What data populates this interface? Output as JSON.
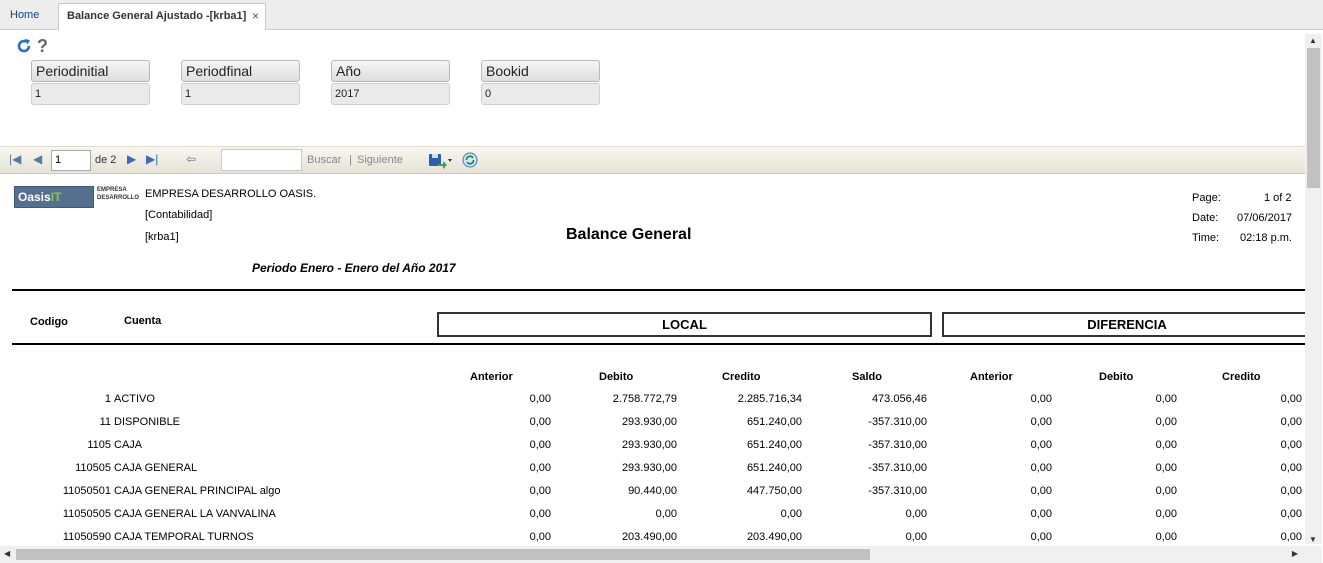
{
  "tabs": {
    "home": "Home",
    "active": "Balance General Ajustado -[krba1]",
    "close": "×"
  },
  "params": [
    {
      "label": "Periodinitial",
      "value": "1"
    },
    {
      "label": "Periodfinal",
      "value": "1"
    },
    {
      "label": "Año",
      "value": "2017"
    },
    {
      "label": "Bookid",
      "value": "0"
    }
  ],
  "toolbar": {
    "page": "1",
    "of": "de 2",
    "find": "Buscar",
    "sep": "|",
    "next": "Siguiente"
  },
  "report": {
    "logo": "Oasis",
    "logo_it": "IT",
    "logo_sub1": "EMPRESA",
    "logo_sub2": "DESARROLLO",
    "company": "EMPRESA DESARROLLO OASIS.",
    "module": "[Contabilidad]",
    "user": "[krba1]",
    "title": "Balance General",
    "period": "Periodo Enero  -  Enero  del Año  2017",
    "page_label": "Page:",
    "page_value": "1 of 2",
    "date_label": "Date:",
    "date_value": "07/06/2017",
    "time_label": "Time:",
    "time_value": "02:18 p.m.",
    "col_codigo": "Codigo",
    "col_cuenta": "Cuenta",
    "group_local": "LOCAL",
    "group_diff": "DIFERENCIA",
    "cols": [
      "Anterior",
      "Debito",
      "Credito",
      "Saldo",
      "Anterior",
      "Debito",
      "Credito"
    ]
  },
  "rows": [
    {
      "code": "1",
      "name": "ACTIVO",
      "v": [
        "0,00",
        "2.758.772,79",
        "2.285.716,34",
        "473.056,46",
        "0,00",
        "0,00",
        "0,00"
      ]
    },
    {
      "code": "11",
      "name": "DISPONIBLE",
      "v": [
        "0,00",
        "293.930,00",
        "651.240,00",
        "-357.310,00",
        "0,00",
        "0,00",
        "0,00"
      ]
    },
    {
      "code": "1105",
      "name": "CAJA",
      "v": [
        "0,00",
        "293.930,00",
        "651.240,00",
        "-357.310,00",
        "0,00",
        "0,00",
        "0,00"
      ]
    },
    {
      "code": "110505",
      "name": "CAJA GENERAL",
      "v": [
        "0,00",
        "293.930,00",
        "651.240,00",
        "-357.310,00",
        "0,00",
        "0,00",
        "0,00"
      ]
    },
    {
      "code": "11050501",
      "name": "CAJA GENERAL PRINCIPAL algo",
      "v": [
        "0,00",
        "90.440,00",
        "447.750,00",
        "-357.310,00",
        "0,00",
        "0,00",
        "0,00"
      ]
    },
    {
      "code": "11050505",
      "name": "CAJA GENERAL LA VANVALINA",
      "v": [
        "0,00",
        "0,00",
        "0,00",
        "0,00",
        "0,00",
        "0,00",
        "0,00"
      ]
    },
    {
      "code": "11050590",
      "name": "CAJA TEMPORAL TURNOS",
      "v": [
        "0,00",
        "203.490,00",
        "203.490,00",
        "0,00",
        "0,00",
        "0,00",
        "0,00"
      ]
    }
  ]
}
